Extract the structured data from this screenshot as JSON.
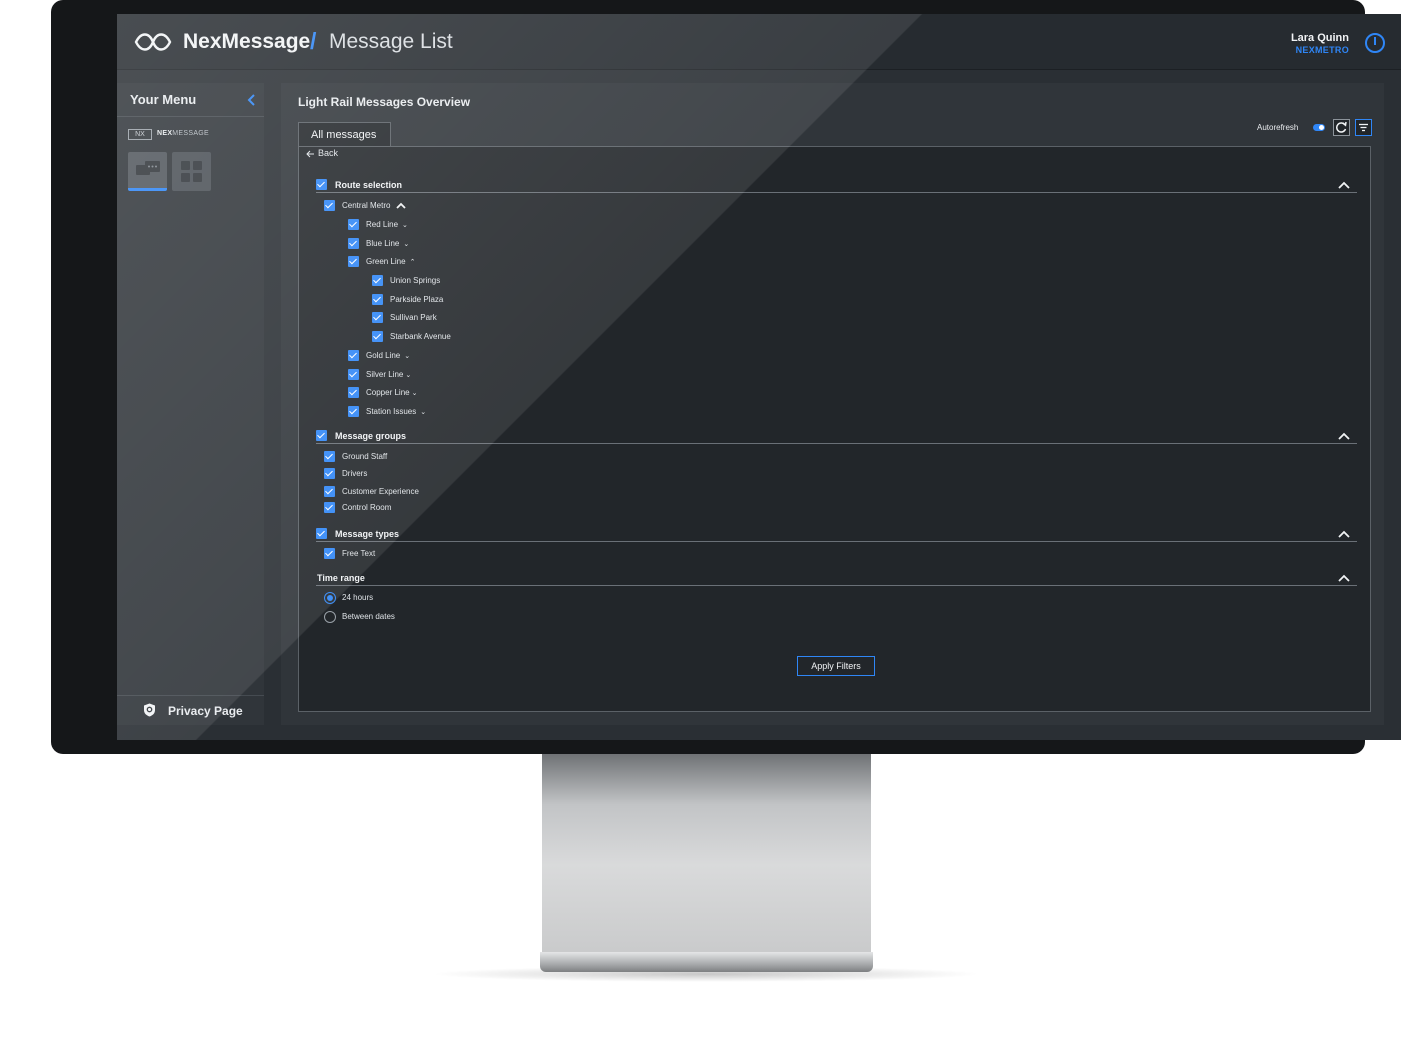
{
  "app": {
    "name": "NexMessage",
    "separator": "/",
    "page": "Message List",
    "accent_color": "#2f86f6"
  },
  "user": {
    "name": "Lara Quinn",
    "org": "NEXMETRO",
    "power_icon": "power-icon"
  },
  "sidebar": {
    "title": "Your Menu",
    "collapse_icon": "chevron-left-icon",
    "brand_badge": "NX",
    "brand_prefix": "NEX",
    "brand_suffix": "MESSAGE",
    "apps": [
      {
        "icon": "messages-icon",
        "active": true
      },
      {
        "icon": "dashboard-grid-icon",
        "active": false
      }
    ],
    "privacy_label": "Privacy Page",
    "privacy_icon": "shield-icon"
  },
  "main": {
    "title": "Light Rail Messages Overview",
    "tab_label": "All messages",
    "autorefresh_label": "Autorefresh",
    "autorefresh_on": true,
    "back_label": "Back",
    "route_selection": {
      "label": "Route selection",
      "checked": true,
      "network": {
        "label": "Central Metro",
        "checked": true,
        "expanded": true
      },
      "lines": [
        {
          "label": "Red Line",
          "checked": true,
          "expanded": false
        },
        {
          "label": "Blue Line",
          "checked": true,
          "expanded": false
        },
        {
          "label": "Green Line",
          "checked": true,
          "expanded": true
        },
        {
          "label": "Gold Line",
          "checked": true,
          "expanded": false
        },
        {
          "label": "Silver Line",
          "checked": true,
          "expanded": false
        },
        {
          "label": "Copper Line",
          "checked": true,
          "expanded": false
        },
        {
          "label": "Station Issues",
          "checked": true,
          "expanded": false
        }
      ],
      "green_line_stations": [
        {
          "label": "Union Springs",
          "checked": true
        },
        {
          "label": "Parkside Plaza",
          "checked": true
        },
        {
          "label": "Sullivan Park",
          "checked": true
        },
        {
          "label": "Starbank Avenue",
          "checked": true
        }
      ]
    },
    "message_groups": {
      "label": "Message groups",
      "checked": true,
      "items": [
        {
          "label": "Ground Staff",
          "checked": true
        },
        {
          "label": "Drivers",
          "checked": true
        },
        {
          "label": "Customer Experience",
          "checked": true
        },
        {
          "label": "Control Room",
          "checked": true
        }
      ]
    },
    "message_types": {
      "label": "Message types",
      "checked": true,
      "items": [
        {
          "label": "Free Text",
          "checked": true
        }
      ]
    },
    "time_range": {
      "label": "Time range",
      "options": [
        {
          "label": "24 hours",
          "selected": true
        },
        {
          "label": "Between dates",
          "selected": false
        }
      ]
    },
    "apply_label": "Apply Filters"
  }
}
